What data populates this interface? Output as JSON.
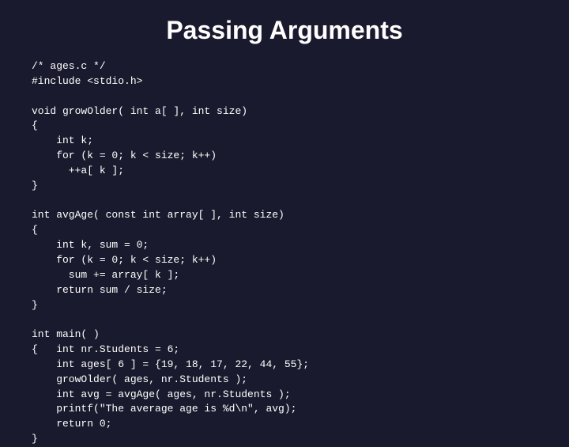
{
  "slide": {
    "title": "Passing Arguments",
    "code_lines": [
      "/* ages.c */",
      "#include <stdio.h>",
      "",
      "void growOlder( int a[ ], int size)",
      "{",
      "    int k;",
      "    for (k = 0; k < size; k++)",
      "      ++a[ k ];",
      "}",
      "",
      "int avgAge( const int array[ ], int size)",
      "{",
      "    int k, sum = 0;",
      "    for (k = 0; k < size; k++)",
      "      sum += array[ k ];",
      "    return sum / size;",
      "}",
      "",
      "int main( )",
      "{   int nr.Students = 6;",
      "    int ages[ 6 ] = {19, 18, 17, 22, 44, 55};",
      "    growOlder( ages, nr.Students );",
      "    int avg = avgAge( ages, nr.Students );",
      "    printf(\"The average age is %d\\n\", avg);",
      "    return 0;",
      "}"
    ]
  }
}
